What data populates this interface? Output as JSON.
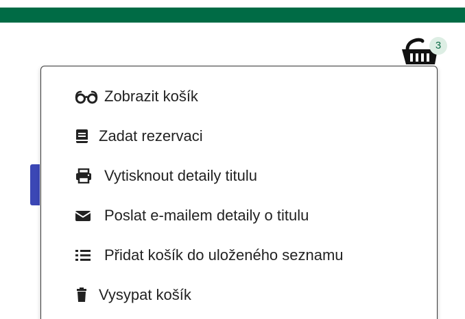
{
  "header": {
    "bar_color": "#006b45"
  },
  "cart": {
    "count": "3",
    "icon": "shopping-basket-icon"
  },
  "menu": {
    "items": [
      {
        "icon": "glasses-icon",
        "label": "Zobrazit košík"
      },
      {
        "icon": "book-icon",
        "label": "Zadat rezervaci"
      },
      {
        "icon": "printer-icon",
        "label": "Vytisknout detaily titulu"
      },
      {
        "icon": "envelope-icon",
        "label": "Poslat e-mailem detaily o titulu"
      },
      {
        "icon": "list-icon",
        "label": "Přidat košík do uloženého seznamu"
      },
      {
        "icon": "trash-icon",
        "label": "Vysypat košík"
      }
    ]
  }
}
